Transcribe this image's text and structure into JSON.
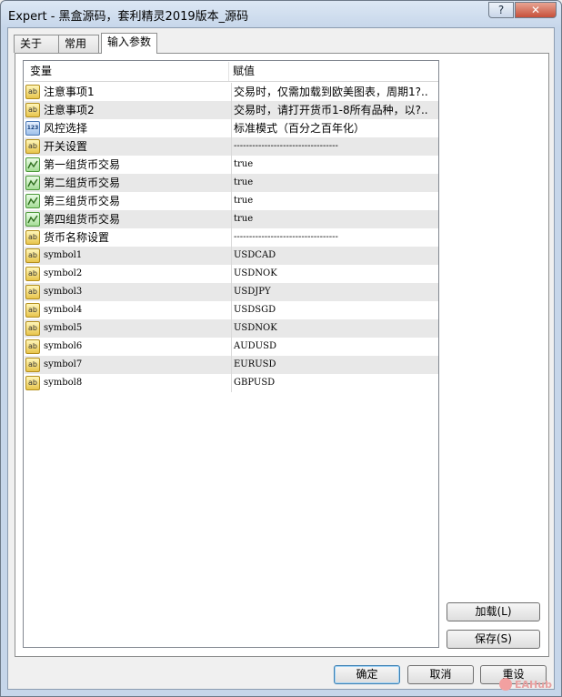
{
  "window": {
    "title": "Expert - 黑盒源码，套利精灵2019版本_源码",
    "help_label": "?",
    "close_label": "✕"
  },
  "tabs": [
    {
      "label": "关于"
    },
    {
      "label": "常用"
    },
    {
      "label": "输入参数"
    }
  ],
  "grid": {
    "col_variable": "变量",
    "col_value": "赋值",
    "rows": [
      {
        "name": "注意事项1",
        "value": "交易时，仅需加载到欧美图表，周期1?..",
        "icon": "ab-icon"
      },
      {
        "name": "注意事项2",
        "value": "交易时，请打开货币1-8所有品种，以?..",
        "icon": "ab-icon"
      },
      {
        "name": "风控选择",
        "value": "标准模式（百分之百年化）",
        "icon": "123-icon"
      },
      {
        "name": "开关设置",
        "value": "----------------------------------",
        "icon": "ab-icon"
      },
      {
        "name": "第一组货币交易",
        "value": "true",
        "icon": "bool-icon"
      },
      {
        "name": "第二组货币交易",
        "value": "true",
        "icon": "bool-icon"
      },
      {
        "name": "第三组货币交易",
        "value": "true",
        "icon": "bool-icon"
      },
      {
        "name": "第四组货币交易",
        "value": "true",
        "icon": "bool-icon"
      },
      {
        "name": "货币名称设置",
        "value": "----------------------------------",
        "icon": "ab-icon"
      },
      {
        "name": "symbol1",
        "value": "USDCAD",
        "icon": "ab-icon"
      },
      {
        "name": "symbol2",
        "value": "USDNOK",
        "icon": "ab-icon"
      },
      {
        "name": "symbol3",
        "value": "USDJPY",
        "icon": "ab-icon"
      },
      {
        "name": "symbol4",
        "value": "USDSGD",
        "icon": "ab-icon"
      },
      {
        "name": "symbol5",
        "value": "USDNOK",
        "icon": "ab-icon"
      },
      {
        "name": "symbol6",
        "value": "AUDUSD",
        "icon": "ab-icon"
      },
      {
        "name": "symbol7",
        "value": "EURUSD",
        "icon": "ab-icon"
      },
      {
        "name": "symbol8",
        "value": "GBPUSD",
        "icon": "ab-icon"
      }
    ]
  },
  "buttons": {
    "load": "加载(L)",
    "save": "保存(S)",
    "ok": "确定",
    "cancel": "取消",
    "reset": "重设"
  },
  "watermark": {
    "text": "EAHub"
  }
}
